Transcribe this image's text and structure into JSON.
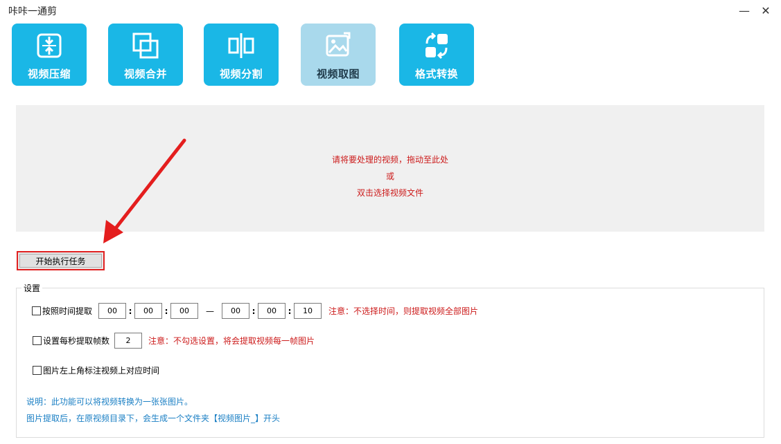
{
  "window": {
    "title": "咔咔一通剪",
    "minimize_glyph": "—",
    "close_glyph": "✕"
  },
  "tools": [
    {
      "label": "视频压缩",
      "icon": "compress-icon",
      "active": false
    },
    {
      "label": "视频合并",
      "icon": "merge-icon",
      "active": false
    },
    {
      "label": "视频分割",
      "icon": "split-icon",
      "active": false
    },
    {
      "label": "视频取图",
      "icon": "image-extract-icon",
      "active": true
    },
    {
      "label": "格式转换",
      "icon": "format-convert-icon",
      "active": false
    }
  ],
  "drop_area": {
    "line1": "请将要处理的视频，拖动至此处",
    "line2": "或",
    "line3": "双击选择视频文件"
  },
  "start_button": "开始执行任务",
  "settings": {
    "legend": "设置",
    "by_time": {
      "label": "按照时间提取",
      "checked": false,
      "start": [
        "00",
        "00",
        "00"
      ],
      "end": [
        "00",
        "00",
        "10"
      ],
      "separator": "—",
      "note": "注意：不选择时间，则提取视频全部图片"
    },
    "per_second": {
      "label": "设置每秒提取帧数",
      "checked": false,
      "value": "2",
      "note": "注意：不勾选设置，将会提取视频每一帧图片"
    },
    "timestamp": {
      "label": "图片左上角标注视频上对应时间",
      "checked": false
    },
    "info1": "说明：此功能可以将视频转换为一张张图片。",
    "info2": "图片提取后，在原视频目录下，会生成一个文件夹【视频图片_】开头"
  },
  "colors": {
    "tool_bg": "#1ab7e6",
    "tool_active_bg": "#a9d9ec",
    "drop_bg": "#f0f0f0",
    "warning_red": "#cc1a1a",
    "info_blue": "#1a7fc4",
    "highlight": "#e02020"
  }
}
